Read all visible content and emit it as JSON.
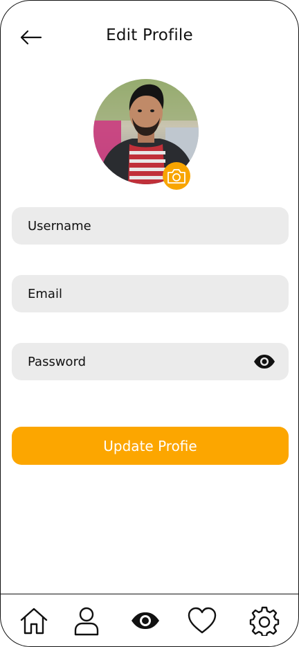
{
  "header": {
    "title": "Edit Profile",
    "back_icon": "arrow-left-icon"
  },
  "profile": {
    "avatar_alt": "Profile photo",
    "camera_icon": "camera-icon",
    "accent_color": "#fca600"
  },
  "form": {
    "username_placeholder": "Username",
    "email_placeholder": "Email",
    "password_placeholder": "Password",
    "password_toggle_icon": "eye-icon",
    "submit_label": "Update Profie"
  },
  "bottom_nav": {
    "items": [
      {
        "icon": "home-icon"
      },
      {
        "icon": "user-icon"
      },
      {
        "icon": "eye-icon"
      },
      {
        "icon": "heart-icon"
      },
      {
        "icon": "settings-icon"
      }
    ]
  }
}
